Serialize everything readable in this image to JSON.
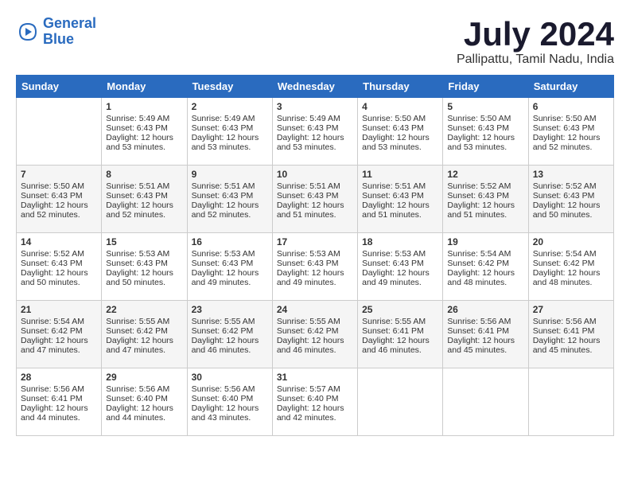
{
  "header": {
    "logo_line1": "General",
    "logo_line2": "Blue",
    "month": "July 2024",
    "location": "Pallipattu, Tamil Nadu, India"
  },
  "weekdays": [
    "Sunday",
    "Monday",
    "Tuesday",
    "Wednesday",
    "Thursday",
    "Friday",
    "Saturday"
  ],
  "weeks": [
    [
      {
        "day": "",
        "info": ""
      },
      {
        "day": "1",
        "info": "Sunrise: 5:49 AM\nSunset: 6:43 PM\nDaylight: 12 hours\nand 53 minutes."
      },
      {
        "day": "2",
        "info": "Sunrise: 5:49 AM\nSunset: 6:43 PM\nDaylight: 12 hours\nand 53 minutes."
      },
      {
        "day": "3",
        "info": "Sunrise: 5:49 AM\nSunset: 6:43 PM\nDaylight: 12 hours\nand 53 minutes."
      },
      {
        "day": "4",
        "info": "Sunrise: 5:50 AM\nSunset: 6:43 PM\nDaylight: 12 hours\nand 53 minutes."
      },
      {
        "day": "5",
        "info": "Sunrise: 5:50 AM\nSunset: 6:43 PM\nDaylight: 12 hours\nand 53 minutes."
      },
      {
        "day": "6",
        "info": "Sunrise: 5:50 AM\nSunset: 6:43 PM\nDaylight: 12 hours\nand 52 minutes."
      }
    ],
    [
      {
        "day": "7",
        "info": "Sunrise: 5:50 AM\nSunset: 6:43 PM\nDaylight: 12 hours\nand 52 minutes."
      },
      {
        "day": "8",
        "info": "Sunrise: 5:51 AM\nSunset: 6:43 PM\nDaylight: 12 hours\nand 52 minutes."
      },
      {
        "day": "9",
        "info": "Sunrise: 5:51 AM\nSunset: 6:43 PM\nDaylight: 12 hours\nand 52 minutes."
      },
      {
        "day": "10",
        "info": "Sunrise: 5:51 AM\nSunset: 6:43 PM\nDaylight: 12 hours\nand 51 minutes."
      },
      {
        "day": "11",
        "info": "Sunrise: 5:51 AM\nSunset: 6:43 PM\nDaylight: 12 hours\nand 51 minutes."
      },
      {
        "day": "12",
        "info": "Sunrise: 5:52 AM\nSunset: 6:43 PM\nDaylight: 12 hours\nand 51 minutes."
      },
      {
        "day": "13",
        "info": "Sunrise: 5:52 AM\nSunset: 6:43 PM\nDaylight: 12 hours\nand 50 minutes."
      }
    ],
    [
      {
        "day": "14",
        "info": "Sunrise: 5:52 AM\nSunset: 6:43 PM\nDaylight: 12 hours\nand 50 minutes."
      },
      {
        "day": "15",
        "info": "Sunrise: 5:53 AM\nSunset: 6:43 PM\nDaylight: 12 hours\nand 50 minutes."
      },
      {
        "day": "16",
        "info": "Sunrise: 5:53 AM\nSunset: 6:43 PM\nDaylight: 12 hours\nand 49 minutes."
      },
      {
        "day": "17",
        "info": "Sunrise: 5:53 AM\nSunset: 6:43 PM\nDaylight: 12 hours\nand 49 minutes."
      },
      {
        "day": "18",
        "info": "Sunrise: 5:53 AM\nSunset: 6:43 PM\nDaylight: 12 hours\nand 49 minutes."
      },
      {
        "day": "19",
        "info": "Sunrise: 5:54 AM\nSunset: 6:42 PM\nDaylight: 12 hours\nand 48 minutes."
      },
      {
        "day": "20",
        "info": "Sunrise: 5:54 AM\nSunset: 6:42 PM\nDaylight: 12 hours\nand 48 minutes."
      }
    ],
    [
      {
        "day": "21",
        "info": "Sunrise: 5:54 AM\nSunset: 6:42 PM\nDaylight: 12 hours\nand 47 minutes."
      },
      {
        "day": "22",
        "info": "Sunrise: 5:55 AM\nSunset: 6:42 PM\nDaylight: 12 hours\nand 47 minutes."
      },
      {
        "day": "23",
        "info": "Sunrise: 5:55 AM\nSunset: 6:42 PM\nDaylight: 12 hours\nand 46 minutes."
      },
      {
        "day": "24",
        "info": "Sunrise: 5:55 AM\nSunset: 6:42 PM\nDaylight: 12 hours\nand 46 minutes."
      },
      {
        "day": "25",
        "info": "Sunrise: 5:55 AM\nSunset: 6:41 PM\nDaylight: 12 hours\nand 46 minutes."
      },
      {
        "day": "26",
        "info": "Sunrise: 5:56 AM\nSunset: 6:41 PM\nDaylight: 12 hours\nand 45 minutes."
      },
      {
        "day": "27",
        "info": "Sunrise: 5:56 AM\nSunset: 6:41 PM\nDaylight: 12 hours\nand 45 minutes."
      }
    ],
    [
      {
        "day": "28",
        "info": "Sunrise: 5:56 AM\nSunset: 6:41 PM\nDaylight: 12 hours\nand 44 minutes."
      },
      {
        "day": "29",
        "info": "Sunrise: 5:56 AM\nSunset: 6:40 PM\nDaylight: 12 hours\nand 44 minutes."
      },
      {
        "day": "30",
        "info": "Sunrise: 5:56 AM\nSunset: 6:40 PM\nDaylight: 12 hours\nand 43 minutes."
      },
      {
        "day": "31",
        "info": "Sunrise: 5:57 AM\nSunset: 6:40 PM\nDaylight: 12 hours\nand 42 minutes."
      },
      {
        "day": "",
        "info": ""
      },
      {
        "day": "",
        "info": ""
      },
      {
        "day": "",
        "info": ""
      }
    ]
  ]
}
